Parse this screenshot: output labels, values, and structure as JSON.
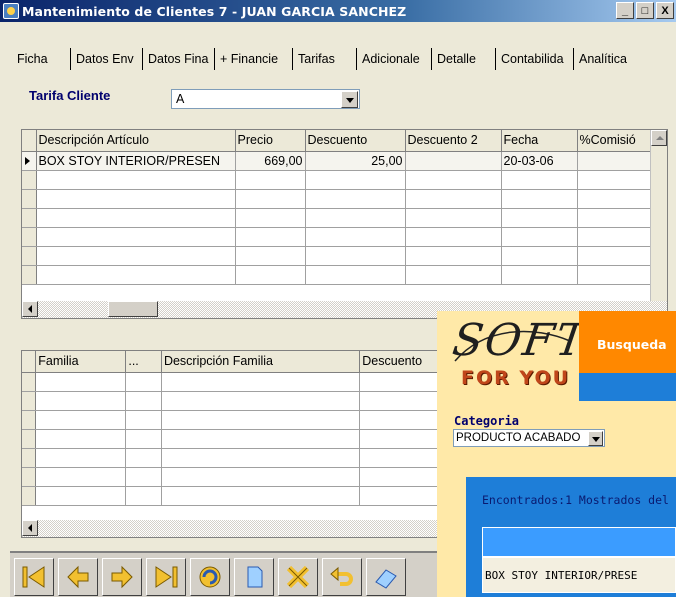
{
  "window": {
    "title": "Mantenimiento de Clientes 7 - JUAN GARCIA SANCHEZ",
    "controls": [
      "_",
      "□",
      "X"
    ]
  },
  "tabs": [
    {
      "label": "Ficha"
    },
    {
      "label": "Datos Env"
    },
    {
      "label": "Datos Fina"
    },
    {
      "label": "+ Financie"
    },
    {
      "label": "Tarifas",
      "active": true
    },
    {
      "label": "Adicionale"
    },
    {
      "label": "Detalle"
    },
    {
      "label": "Contabilida"
    },
    {
      "label": "Analítica"
    }
  ],
  "tarifa": {
    "label": "Tarifa Cliente",
    "value": "A"
  },
  "articles_grid": {
    "columns": [
      "Descripción Artículo",
      "Precio",
      "Descuento",
      "Descuento 2",
      "Fecha",
      "%Comisió"
    ],
    "rows": [
      [
        "BOX STOY INTERIOR/PRESEN",
        "669,00",
        "25,00",
        "",
        "20-03-06",
        ""
      ]
    ],
    "empty_rows": 6
  },
  "family_grid": {
    "columns": [
      "Familia",
      "...",
      "Descripción Familia",
      "Descuento"
    ],
    "empty_rows": 7
  },
  "toolbar": {
    "buttons": [
      {
        "name": "first-record-button",
        "icon": "first-icon"
      },
      {
        "name": "prev-record-button",
        "icon": "prev-icon"
      },
      {
        "name": "next-record-button",
        "icon": "next-icon"
      },
      {
        "name": "last-record-button",
        "icon": "last-icon"
      },
      {
        "name": "refresh-button",
        "icon": "refresh-icon"
      },
      {
        "name": "new-record-button",
        "icon": "document-icon"
      },
      {
        "name": "delete-button",
        "icon": "delete-icon"
      },
      {
        "name": "undo-button",
        "icon": "undo-icon"
      },
      {
        "name": "eraser-button",
        "icon": "eraser-icon"
      }
    ]
  },
  "softforyou": {
    "logo_top": "SOFT",
    "logo_bottom": "FOR YOU",
    "search_title": "Busqueda",
    "category_label": "Categoria",
    "category_value": "PRODUCTO ACABADO",
    "found_text": "Encontrados:1 Mostrados del",
    "result_row": "BOX STOY INTERIOR/PRESE",
    "colors": {
      "orange": "#ff8800",
      "blue": "#1e7ed8",
      "cream": "#ffe9a8"
    }
  }
}
